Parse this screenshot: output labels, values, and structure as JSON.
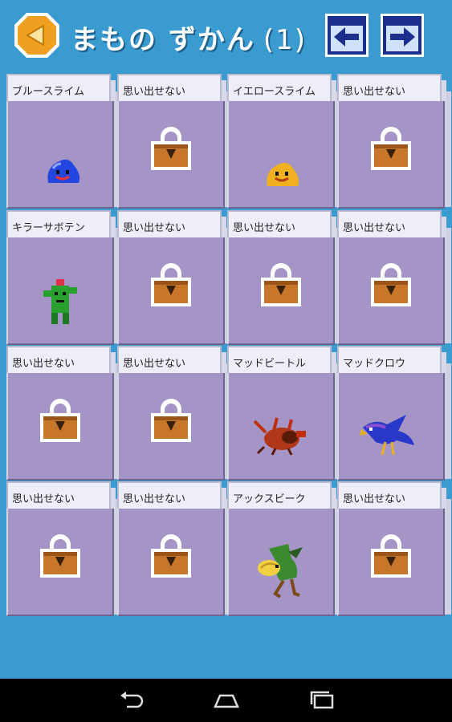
{
  "header": {
    "title": "まもの ずかん",
    "page_number": "(1)"
  },
  "colors": {
    "background": "#3a9bd0",
    "panel": "#a594c6",
    "tab": "#eeeef8",
    "back_button": "#f0a020"
  },
  "cards": [
    {
      "label": "ブルースライム",
      "art": "blue-slime-icon"
    },
    {
      "label": "思い出せない",
      "art": "lock-icon"
    },
    {
      "label": "イエロースライム",
      "art": "yellow-slime-icon"
    },
    {
      "label": "思い出せない",
      "art": "lock-icon"
    },
    {
      "label": "キラーサボテン",
      "art": "cactus-monster-icon"
    },
    {
      "label": "思い出せない",
      "art": "lock-icon"
    },
    {
      "label": "思い出せない",
      "art": "lock-icon"
    },
    {
      "label": "思い出せない",
      "art": "lock-icon"
    },
    {
      "label": "思い出せない",
      "art": "lock-icon"
    },
    {
      "label": "思い出せない",
      "art": "lock-icon"
    },
    {
      "label": "マッドビートル",
      "art": "beetle-monster-icon"
    },
    {
      "label": "マッドクロウ",
      "art": "crow-monster-icon"
    },
    {
      "label": "思い出せない",
      "art": "lock-icon"
    },
    {
      "label": "思い出せない",
      "art": "lock-icon"
    },
    {
      "label": "アックスビーク",
      "art": "axe-beak-monster-icon"
    },
    {
      "label": "思い出せない",
      "art": "lock-icon"
    }
  ],
  "system_bar": {
    "icons": [
      "back-arrow-icon",
      "home-icon",
      "recent-apps-icon"
    ]
  }
}
